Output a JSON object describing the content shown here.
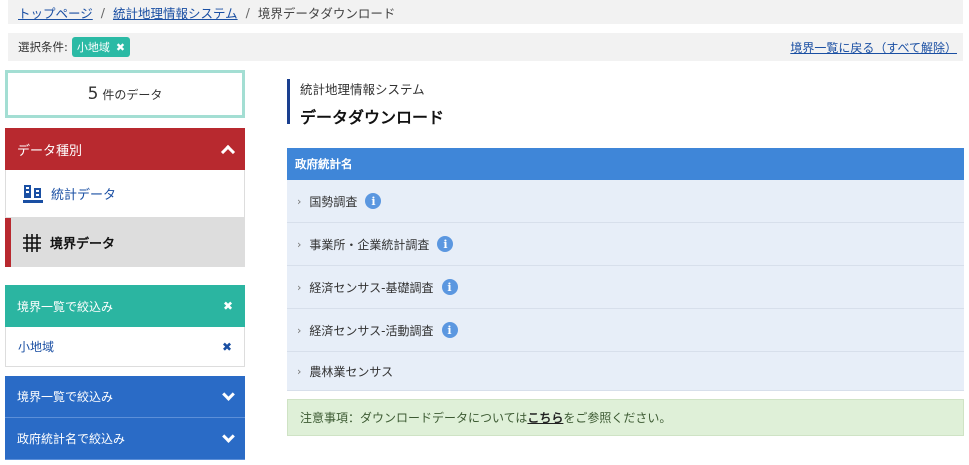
{
  "breadcrumb": {
    "home": "トップページ",
    "system": "統計地理情報システム",
    "current": "境界データダウンロード",
    "separator": "/"
  },
  "conditions": {
    "label": "選択条件:",
    "chip": "小地域",
    "reset_link": "境界一覧に戻る（すべて解除）"
  },
  "sidebar": {
    "count_number": "5",
    "count_unit": "件のデータ",
    "data_type_header": "データ種別",
    "data_types": [
      {
        "label": "統計データ",
        "icon": "building-icon"
      },
      {
        "label": "境界データ",
        "icon": "grid-icon"
      }
    ],
    "filter_header": "境界一覧で絞込み",
    "filter_selected": "小地域",
    "collapsed_filters": [
      {
        "label": "境界一覧で絞込み"
      },
      {
        "label": "政府統計名で絞込み"
      }
    ]
  },
  "main": {
    "system_name": "統計地理情報システム",
    "page_title": "データダウンロード",
    "table_header": "政府統計名",
    "rows": [
      {
        "label": "国勢調査",
        "info": true
      },
      {
        "label": "事業所・企業統計調査",
        "info": true
      },
      {
        "label": "経済センサス‐基礎調査",
        "info": true
      },
      {
        "label": "経済センサス‐活動調査",
        "info": true
      },
      {
        "label": "農林業センサス",
        "info": false
      }
    ],
    "notice_prefix": "注意事項：ダウンロードデータについては",
    "notice_link": "こちら",
    "notice_suffix": "をご参照ください。"
  },
  "colors": {
    "teal": "#2bb5a1",
    "red": "#b8292f",
    "blue": "#2a6bc6",
    "table_header": "#3f86d8",
    "link": "#1a4fa3"
  }
}
